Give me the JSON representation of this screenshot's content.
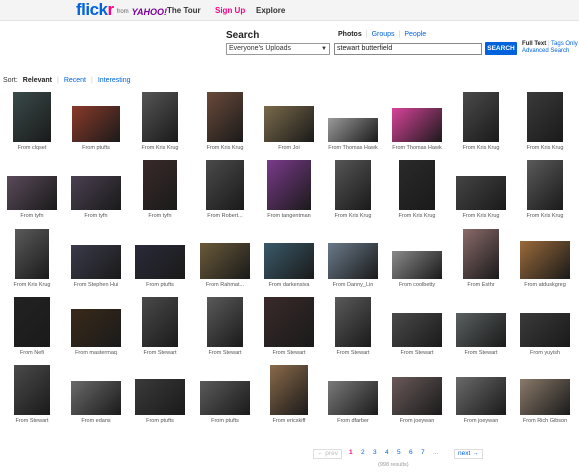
{
  "topbar": {
    "logo_text_1": "flick",
    "logo_text_2": "r",
    "logo_from": "from",
    "logo_yahoo": "YAHOO!",
    "nav": [
      "The Tour",
      "Sign Up",
      "Explore"
    ]
  },
  "search": {
    "title": "Search",
    "scope_value": "Everyone's Uploads",
    "tabs": [
      "Photos",
      "Groups",
      "People"
    ],
    "query": "stewart butterfield",
    "button": "SEARCH",
    "full_text": "Full Text",
    "tags_only": "Tags Only",
    "advanced": "Advanced Search"
  },
  "sort": {
    "label": "Sort:",
    "options": [
      "Relevant",
      "Recent",
      "Interesting"
    ]
  },
  "results": [
    {
      "caption": "From clqset",
      "color": "#3a4a4a"
    },
    {
      "caption": "From ptufts",
      "color": "#8a3a2a"
    },
    {
      "caption": "From Kris Krug",
      "color": "#555555"
    },
    {
      "caption": "From Kris Krug",
      "color": "#6a4a3a"
    },
    {
      "caption": "From Joi",
      "color": "#7a6a4a"
    },
    {
      "caption": "From Thomas Hawk",
      "color": "#9a9a9a"
    },
    {
      "caption": "From Thomas Hawk",
      "color": "#d8439a"
    },
    {
      "caption": "From Kris Krug",
      "color": "#4a4a4a"
    },
    {
      "caption": "From Kris Krug",
      "color": "#3a3a3a"
    },
    {
      "caption": "From tyfn",
      "color": "#5a4a5a"
    },
    {
      "caption": "From tyfn",
      "color": "#4a4050"
    },
    {
      "caption": "From tyfn",
      "color": "#3a2a2a"
    },
    {
      "caption": "From Robert...",
      "color": "#4a4a4a"
    },
    {
      "caption": "From tangentman",
      "color": "#7a3a8a"
    },
    {
      "caption": "From Kris Krug",
      "color": "#555555"
    },
    {
      "caption": "From Kris Krug",
      "color": "#2a2a2a"
    },
    {
      "caption": "From Kris Krug",
      "color": "#444444"
    },
    {
      "caption": "From Kris Krug",
      "color": "#5a5a5a"
    },
    {
      "caption": "From Kris Krug",
      "color": "#5a5a5a"
    },
    {
      "caption": "From Stephen Hui",
      "color": "#3a3a4a"
    },
    {
      "caption": "From ptufts",
      "color": "#2a2a3a"
    },
    {
      "caption": "From Rahmat...",
      "color": "#6a5a3a"
    },
    {
      "caption": "From darkensiva",
      "color": "#3a5a6a"
    },
    {
      "caption": "From Danny_Lin",
      "color": "#6a7a8a"
    },
    {
      "caption": "From coolbetty",
      "color": "#8a8a8a"
    },
    {
      "caption": "From Esthr",
      "color": "#8a6a6a"
    },
    {
      "caption": "From atduskgreg",
      "color": "#9a6a3a"
    },
    {
      "caption": "From Nefi",
      "color": "#222222"
    },
    {
      "caption": "From mastermaq",
      "color": "#3a2a1a"
    },
    {
      "caption": "From Stewart",
      "color": "#4a4a4a"
    },
    {
      "caption": "From Stewart",
      "color": "#5a5a5a"
    },
    {
      "caption": "From Stewart",
      "color": "#3a2a2a"
    },
    {
      "caption": "From Stewart",
      "color": "#5a5a5a"
    },
    {
      "caption": "From Stewart",
      "color": "#4a4a4a"
    },
    {
      "caption": "From Stewart",
      "color": "#5a6060"
    },
    {
      "caption": "From yuyish",
      "color": "#3a3a3a"
    },
    {
      "caption": "From Stewart",
      "color": "#4a4a4a"
    },
    {
      "caption": "From edans",
      "color": "#6a6a6a"
    },
    {
      "caption": "From ptufts",
      "color": "#3a3a3a"
    },
    {
      "caption": "From ptufts",
      "color": "#5a5a5a"
    },
    {
      "caption": "From ericskiff",
      "color": "#8a6a4a"
    },
    {
      "caption": "From dfarber",
      "color": "#7a7a7a"
    },
    {
      "caption": "From joeywan",
      "color": "#6a5a5a"
    },
    {
      "caption": "From joeywan",
      "color": "#6a6a6a"
    },
    {
      "caption": "From Rich Gibson",
      "color": "#8a7a6a"
    }
  ],
  "pager": {
    "prev": "← prev",
    "pages": [
      "1",
      "2",
      "3",
      "4",
      "5",
      "6",
      "7"
    ],
    "current": "1",
    "ellipsis": "...",
    "next": "next →",
    "results_text": "(998 results)"
  }
}
